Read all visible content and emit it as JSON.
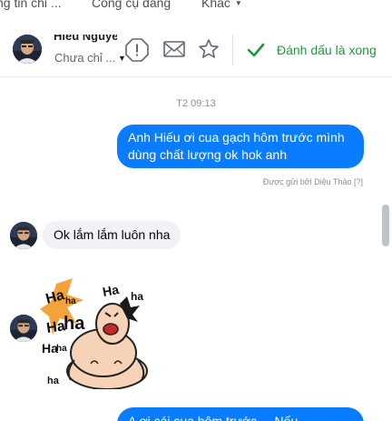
{
  "tabs": {
    "tab1": "ng tin chi ...",
    "tab2": "Công cụ dang",
    "tab3": "Khác",
    "caret": "▼"
  },
  "header": {
    "name": "Hiếu Nguyễn",
    "status": "Chưa chỉ ...",
    "status_caret": "▼",
    "mark_done_label": "Đánh dấu là xong",
    "icons": [
      "alert-icon",
      "mail-icon",
      "star-icon",
      "check-icon"
    ],
    "accent_color": "#1b9a3c"
  },
  "conversation": {
    "timestamp": "T2 09:13",
    "messages": [
      {
        "direction": "outgoing",
        "lines": [
          "Anh Hiếu ơi cua gạch hôm trước mình",
          "dùng chất lượng ok hok anh"
        ]
      },
      {
        "direction": "incoming",
        "text": "Ok lắm lắm luôn nha"
      },
      {
        "direction": "incoming",
        "sticker": "laughing-sticker",
        "sticker_text": [
          "Ha",
          "ha",
          "Ha",
          "ha",
          "Ha",
          "ha",
          "Ha",
          "ha",
          "ha"
        ]
      },
      {
        "direction": "outgoing",
        "text": "A ơi cái cua hôm trước ... Nếu ..."
      }
    ],
    "sent_by": "Được gửi bởi Diệu Thảo",
    "sent_by_help": "[?]",
    "bubble_color": "#0a7cff"
  }
}
